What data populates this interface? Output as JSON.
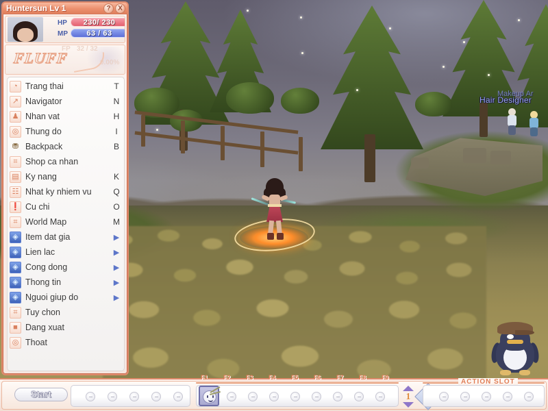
{
  "window": {
    "title": "Huntersun Lv 1",
    "help_button": "?",
    "close_button": "X"
  },
  "status": {
    "hp_label": "HP",
    "mp_label": "MP",
    "hp_value": "230/  230",
    "mp_value": "63 /  63",
    "fp_label": "FP",
    "fp_value": "32 /  32",
    "fp_percent": "0.00%",
    "logo_text": "FLUFF"
  },
  "menu": {
    "items": [
      {
        "label": "Trang thai",
        "key": "T",
        "icon": "status-icon",
        "icon_glyph": "◔",
        "style": "pink",
        "arrow": ""
      },
      {
        "label": "Navigator",
        "key": "N",
        "icon": "navigator-icon",
        "icon_glyph": "↗",
        "style": "grey",
        "arrow": ""
      },
      {
        "label": "Nhan vat",
        "key": "H",
        "icon": "character-icon",
        "icon_glyph": "♟",
        "style": "pink",
        "arrow": ""
      },
      {
        "label": "Thung do",
        "key": "I",
        "icon": "inventory-icon",
        "icon_glyph": "◎",
        "style": "pink",
        "arrow": ""
      },
      {
        "label": "Backpack",
        "key": "B",
        "icon": "backpack-icon",
        "icon_glyph": "⛃",
        "style": "plain",
        "arrow": ""
      },
      {
        "label": "Shop ca nhan",
        "key": "",
        "icon": "shop-icon",
        "icon_glyph": "⌗",
        "style": "pink",
        "arrow": ""
      },
      {
        "label": "Ky nang",
        "key": "K",
        "icon": "skill-icon",
        "icon_glyph": "▤",
        "style": "pink",
        "arrow": ""
      },
      {
        "label": "Nhat ky nhiem vu",
        "key": "Q",
        "icon": "quest-log-icon",
        "icon_glyph": "☷",
        "style": "pink",
        "arrow": ""
      },
      {
        "label": "Cu chi",
        "key": "O",
        "icon": "gesture-icon",
        "icon_glyph": "❗",
        "style": "pink",
        "arrow": ""
      },
      {
        "label": "World Map",
        "key": "M",
        "icon": "world-map-icon",
        "icon_glyph": "⌗",
        "style": "pink",
        "arrow": ""
      },
      {
        "label": "Item dat gia",
        "key": "",
        "icon": "valuable-item-icon",
        "icon_glyph": "◈",
        "style": "blue",
        "arrow": "▶"
      },
      {
        "label": "Lien lac",
        "key": "",
        "icon": "contact-icon",
        "icon_glyph": "◈",
        "style": "blue",
        "arrow": "▶"
      },
      {
        "label": "Cong dong",
        "key": "",
        "icon": "community-icon",
        "icon_glyph": "◈",
        "style": "blue",
        "arrow": "▶"
      },
      {
        "label": "Thong tin",
        "key": "",
        "icon": "information-icon",
        "icon_glyph": "◈",
        "style": "blue",
        "arrow": "▶"
      },
      {
        "label": "Nguoi giup do",
        "key": "",
        "icon": "helper-icon",
        "icon_glyph": "◈",
        "style": "blue",
        "arrow": "▶"
      },
      {
        "label": "Tuy chon",
        "key": "",
        "icon": "options-icon",
        "icon_glyph": "⌗",
        "style": "pink",
        "arrow": ""
      },
      {
        "label": "Dang xuat",
        "key": "",
        "icon": "logout-icon",
        "icon_glyph": "■",
        "style": "pink",
        "arrow": ""
      },
      {
        "label": "Thoat",
        "key": "",
        "icon": "exit-icon",
        "icon_glyph": "◎",
        "style": "pink",
        "arrow": ""
      }
    ]
  },
  "world": {
    "npc_label": "Hair Designer",
    "npc_label_background": "Makeup Ar"
  },
  "taskbar": {
    "start_label": "Start",
    "action_slot_title": "ACTION SLOT",
    "level_number": "1",
    "action_icon_glyph": "S",
    "fkey_labels": [
      "F1",
      "F2",
      "F3",
      "F4",
      "F5",
      "F6",
      "F7",
      "F8",
      "F9"
    ],
    "quick_slot_count": 5,
    "fkey_slot_count": 8,
    "action_slot_count": 5
  },
  "colors": {
    "accent": "#e08a6c",
    "title_bar": "#ec8f6d",
    "hp_bar": "#e4606f",
    "mp_bar": "#5d6fd8",
    "menu_blue_icon": "#3e62b8",
    "npc_label": "#9aa6f0",
    "fkey_label": "#e07d55"
  }
}
